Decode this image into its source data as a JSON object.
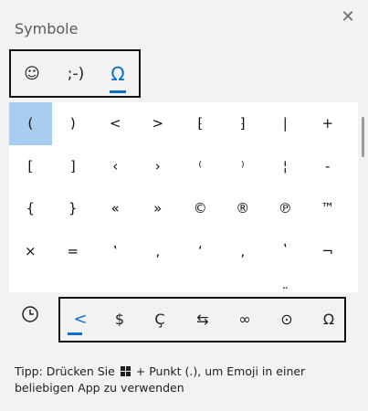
{
  "window": {
    "title": "Symbole",
    "close_glyph": "✕"
  },
  "categories": [
    {
      "name": "emoji",
      "glyph": "☺"
    },
    {
      "name": "kaomoji",
      "glyph": ";-)"
    },
    {
      "name": "symbols",
      "glyph": "Ω",
      "active": true
    }
  ],
  "grid": {
    "selected": "(",
    "rows": [
      [
        "(",
        ")",
        "<",
        ">",
        "⁅",
        "⁆",
        "|",
        "+"
      ],
      [
        "[",
        "]",
        "‹",
        "›",
        "⁽",
        "⁾",
        "¦",
        "-"
      ],
      [
        "{",
        "}",
        "«",
        "»",
        "©",
        "®",
        "℗",
        "™"
      ],
      [
        "×",
        "=",
        "‛",
        "‚",
        "ʻ",
        "‚",
        "ʽ",
        "¬"
      ],
      [
        " ",
        " ",
        " ",
        " ",
        " ",
        " ",
        "¨",
        " "
      ]
    ]
  },
  "subcategories": [
    {
      "name": "punctuation",
      "glyph": "<",
      "active": true
    },
    {
      "name": "currency",
      "glyph": "$"
    },
    {
      "name": "latin",
      "glyph": "Ç"
    },
    {
      "name": "arrows",
      "glyph": "⇆"
    },
    {
      "name": "math",
      "glyph": "∞"
    },
    {
      "name": "geometric",
      "glyph": "⊙"
    },
    {
      "name": "language",
      "glyph": "Ω"
    }
  ],
  "tip": {
    "before": "Tipp: Drücken Sie",
    "after": "+ Punkt (.), um Emoji in einer beliebigen App zu verwenden"
  },
  "colors": {
    "accent": "#0b6fd0",
    "selected_cell": "#a8cdee"
  }
}
